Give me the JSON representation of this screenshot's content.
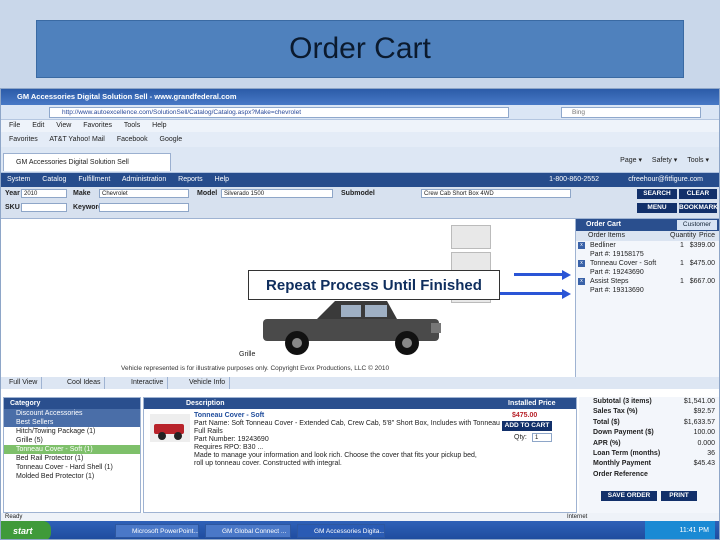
{
  "slide": {
    "title": "Order Cart",
    "callout": "Repeat Process Until Finished"
  },
  "browser": {
    "window_title": "GM Accessories Digital Solution Sell - www.grandfederal.com",
    "url": "http://www.autoexcellence.com/SolutionSell/Catalog/Catalog.aspx?Make=chevrolet",
    "search_placeholder": "Bing",
    "menu": [
      "File",
      "Edit",
      "View",
      "Favorites",
      "Tools",
      "Help"
    ],
    "favorites": [
      "Favorites",
      "AT&T Yahoo! Mail",
      "Facebook",
      "Google"
    ],
    "tab": "GM Accessories Digital Solution Sell",
    "page_tools": [
      "Page ▾",
      "Safety ▾",
      "Tools ▾"
    ]
  },
  "nav": {
    "items": [
      "System",
      "Catalog",
      "Fulfillment",
      "Administration",
      "Reports",
      "Help"
    ],
    "phone": "1-800-860-2552",
    "account": "cfreehour@fitfigure.com"
  },
  "filters": {
    "year_label": "Year",
    "year_value": "2010",
    "make_label": "Make",
    "make_value": "Chevrolet",
    "model_label": "Model",
    "model_value": "Silverado 1500",
    "submodel_label": "Submodel",
    "submodel_value": "Crew Cab Short Box 4WD",
    "skiu_label": "SKU",
    "keyword_label": "Keyword",
    "search": "SEARCH",
    "clear": "CLEAR",
    "menu": "MENU",
    "bookmark": "BOOKMARK"
  },
  "vehicle": {
    "caption": "Grille",
    "disclaimer": "Vehicle represented is for illustrative purposes only. Copyright Evox Productions, LLC © 2010"
  },
  "cart": {
    "header": "Order Cart",
    "customer": "Customer",
    "columns": [
      "Order Items",
      "Quantity",
      "Price"
    ],
    "rows": [
      {
        "name": "Bedliner",
        "qty": "1",
        "price": "$399.00"
      },
      {
        "name": "Part #: 19158175",
        "qty": "",
        "price": ""
      },
      {
        "name": "Tonneau Cover - Soft",
        "qty": "1",
        "price": "$475.00"
      },
      {
        "name": "Part #: 19243690",
        "qty": "",
        "price": ""
      },
      {
        "name": "Assist Steps",
        "qty": "1",
        "price": "$667.00"
      },
      {
        "name": "Part #: 19313690",
        "qty": "",
        "price": ""
      }
    ]
  },
  "view_buttons": [
    "Full View",
    "Cool Ideas",
    "Interactive",
    "Vehicle Info"
  ],
  "category": {
    "header": "Category",
    "items": [
      {
        "label": "Discount Accessories",
        "type": "head"
      },
      {
        "label": "Best Sellers",
        "type": "head"
      },
      {
        "label": "Hitch/Towing Package (1)",
        "type": "item"
      },
      {
        "label": "Grille (5)",
        "type": "item"
      },
      {
        "label": "Tonneau Cover - Soft (1)",
        "type": "selected"
      },
      {
        "label": "Bed Rail Protector (1)",
        "type": "item"
      },
      {
        "label": "Tonneau Cover - Hard Shell (1)",
        "type": "item"
      },
      {
        "label": "Molded Bed Protector (1)",
        "type": "item"
      }
    ]
  },
  "description": {
    "header": "Description",
    "price_header": "Installed Price",
    "title": "Tonneau Cover - Soft",
    "part_name": "Part Name: Soft Tonneau Cover - Extended Cab, Crew Cab, 5'8\" Short Box, Includes with Tonneau",
    "full_rails": "Full Rails",
    "part_number": "Part Number: 19243690",
    "requires": "Requires RPO: B30 ...",
    "details": "Made to manage your information and look rich. Choose the cover that fits your pickup bed, roll up tonneau cover. Constructed with integral.",
    "price": "$475.00",
    "qty_label": "Qty:",
    "qty_value": "1",
    "add_to_cart": "ADD TO CART"
  },
  "summary": {
    "rows": [
      {
        "label": "Subtotal (3 items)",
        "value": "$1,541.00"
      },
      {
        "label": "Sales Tax (%)",
        "value": "$92.57"
      },
      {
        "label": "Total ($)",
        "value": "$1,633.57"
      },
      {
        "label": "Down Payment ($)",
        "value": "100.00"
      },
      {
        "label": "APR (%)",
        "value": "0.000"
      },
      {
        "label": "Loan Term (months)",
        "value": "36"
      },
      {
        "label": "Monthly Payment",
        "value": "$45.43"
      },
      {
        "label": "Order Reference",
        "value": ""
      }
    ],
    "save": "SAVE ORDER",
    "print": "PRINT"
  },
  "status": {
    "left": "Ready",
    "right": "Internet"
  },
  "taskbar": {
    "start": "start",
    "tasks": [
      "Microsoft PowerPoint...",
      "GM Global Connect ...",
      "GM Accessories Digita..."
    ],
    "clock": "11:41 PM"
  }
}
